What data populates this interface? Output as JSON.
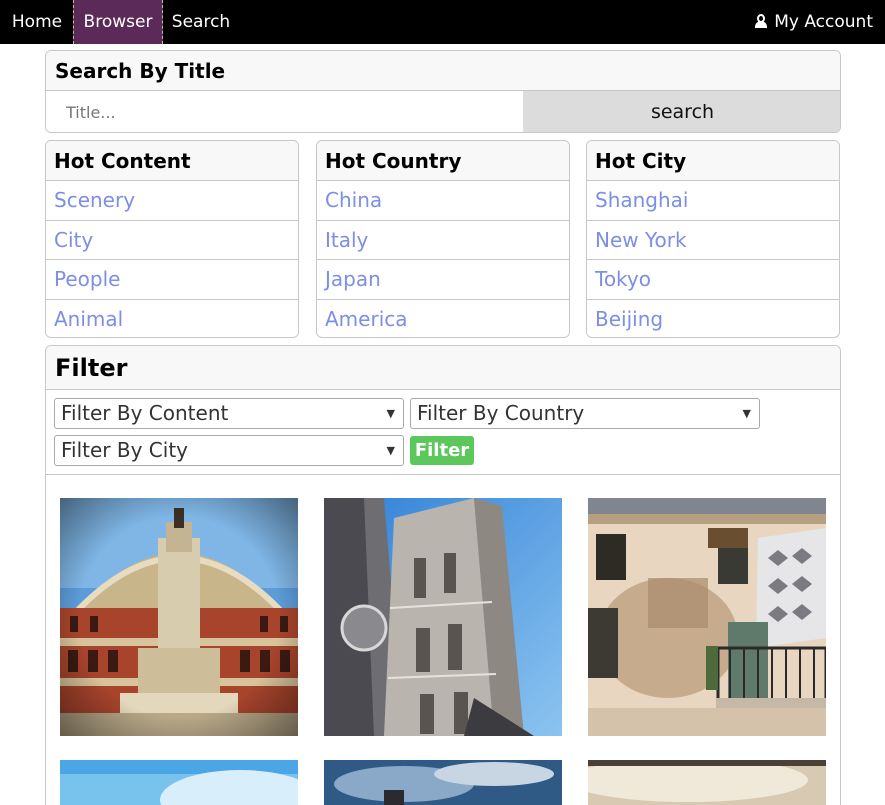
{
  "nav": {
    "home": "Home",
    "browser": "Browser",
    "search": "Search",
    "account": "My Account",
    "account_icon": "user-icon"
  },
  "search_panel": {
    "title": "Search By Title",
    "placeholder": "Title...",
    "button": "search"
  },
  "hot_content": {
    "title": "Hot Content",
    "items": [
      "Scenery",
      "City",
      "People",
      "Animal"
    ]
  },
  "hot_country": {
    "title": "Hot Country",
    "items": [
      "China",
      "Italy",
      "Japan",
      "America"
    ]
  },
  "hot_city": {
    "title": "Hot City",
    "items": [
      "Shanghai",
      "New York",
      "Tokyo",
      "Beijing"
    ]
  },
  "filter": {
    "title": "Filter",
    "content_select": "Filter By Content",
    "country_select": "Filter By Country",
    "city_select": "Filter By City",
    "button": "Filter"
  },
  "colors": {
    "nav_bg": "#000000",
    "nav_active": "#5c2a58",
    "link": "#7c8ee6",
    "filter_button": "#5cc85c",
    "search_button": "#dcdcdc"
  }
}
